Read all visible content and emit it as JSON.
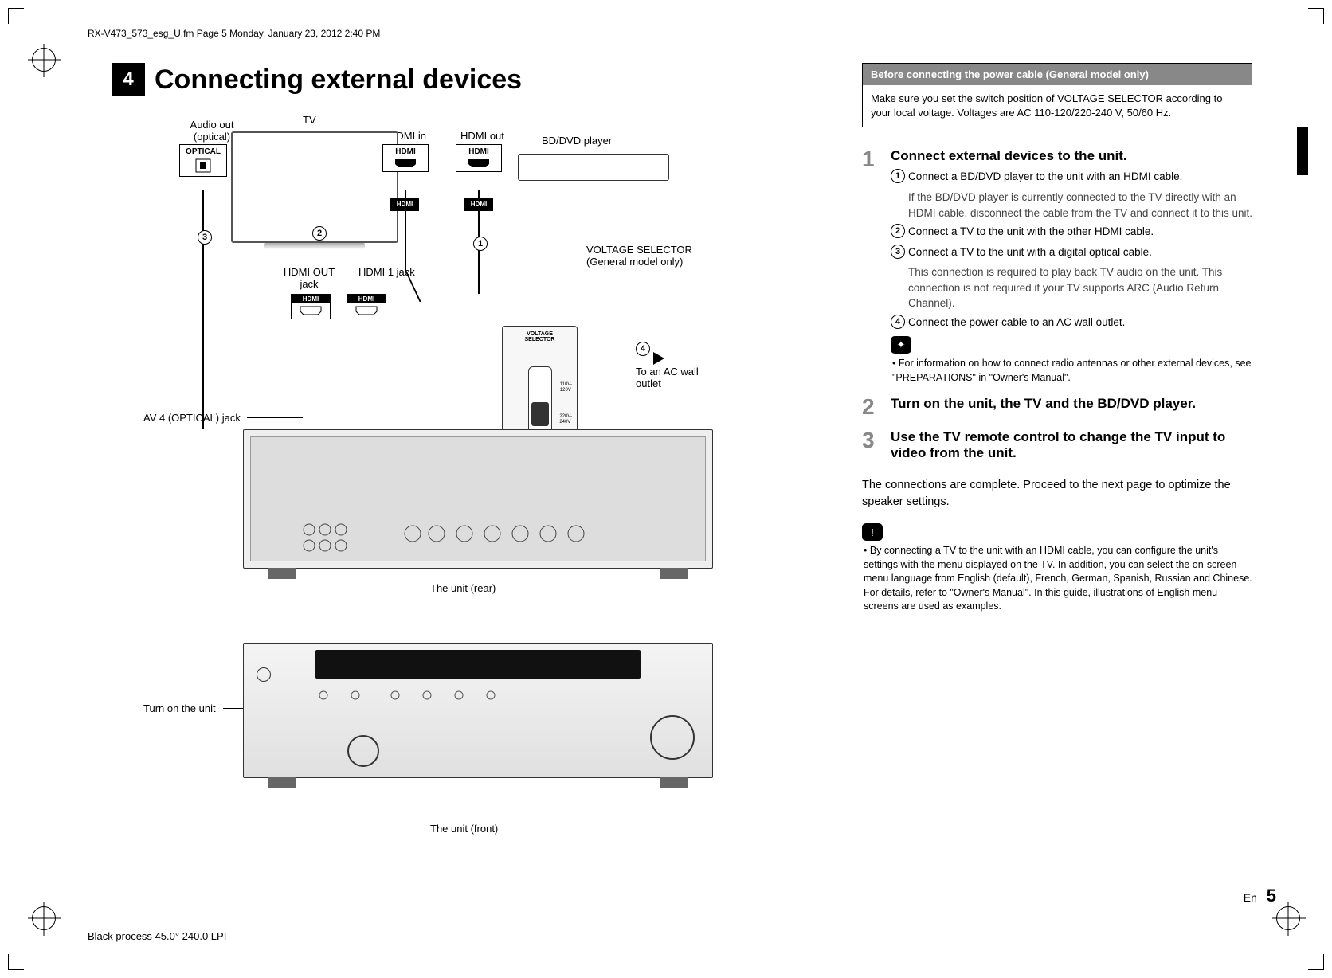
{
  "meta": {
    "header": "RX-V473_573_esg_U.fm  Page 5  Monday, January 23, 2012  2:40 PM",
    "footer_a": "Black",
    "footer_b": " process 45.0° 240.0 LPI"
  },
  "section": {
    "num": "4",
    "title": "Connecting external devices"
  },
  "diagram": {
    "audio_out": "Audio out\n(optical)",
    "tv": "TV",
    "hdmi_in": "HDMI in",
    "hdmi_out": "HDMI out",
    "bddvd": "BD/DVD player",
    "optical": "OPTICAL",
    "hdmi": "HDMI",
    "hdmi_tag": "HDMI",
    "hdmi_out_jack": "HDMI OUT\njack",
    "hdmi1_jack": "HDMI 1 jack",
    "av4_jack": "AV 4 (OPTICAL) jack",
    "voltage_label": "VOLTAGE SELECTOR\n(General model only)",
    "voltage_cap": "VOLTAGE\nSELECTOR",
    "to_ac": "To an AC wall\noutlet",
    "unit_rear": "The unit (rear)",
    "unit_front": "The unit (front)",
    "turn_on": "Turn on the unit",
    "c1": "①",
    "c2": "②",
    "c3": "③",
    "c4": "④",
    "v1": "110V-\n120V",
    "v2": "220V-\n240V"
  },
  "infobox": {
    "bar": "Before connecting the power cable (General model only)",
    "body": "Make sure you set the switch position of VOLTAGE SELECTOR according to your local voltage. Voltages are AC 110-120/220-240 V, 50/60 Hz."
  },
  "steps": {
    "s1": {
      "num": "1",
      "h": "Connect external devices to the unit.",
      "a": "Connect a BD/DVD player to the unit with an HDMI cable.",
      "a_detail": "If the BD/DVD player is currently connected to the TV directly with an HDMI cable, disconnect the cable from the TV and connect it to this unit.",
      "b": "Connect a TV to the unit with the other HDMI cable.",
      "c": "Connect a TV to the unit with a digital optical cable.",
      "c_detail": "This connection is required to play back TV audio on the unit. This connection is not required if your TV supports ARC (Audio Return Channel).",
      "d": "Connect the power cable to an AC wall outlet."
    },
    "tip1": "For information on how to connect radio antennas or other external devices, see \"PREPARATIONS\" in \"Owner's Manual\".",
    "s2": {
      "num": "2",
      "h": "Turn on the unit, the TV and the BD/DVD player."
    },
    "s3": {
      "num": "3",
      "h": "Use the TV remote control to change the TV input to video from the unit."
    },
    "para": "The connections are complete. Proceed to the next page to optimize the speaker settings.",
    "note": "By connecting a TV to the unit with an HDMI cable, you can configure the unit's settings with the menu displayed on the TV. In addition, you can select the on-screen menu language from English (default), French, German, Spanish, Russian and Chinese. For details, refer to \"Owner's Manual\". In this guide, illustrations of English menu screens are used as examples."
  },
  "page": {
    "lang": "En",
    "num": "5"
  }
}
